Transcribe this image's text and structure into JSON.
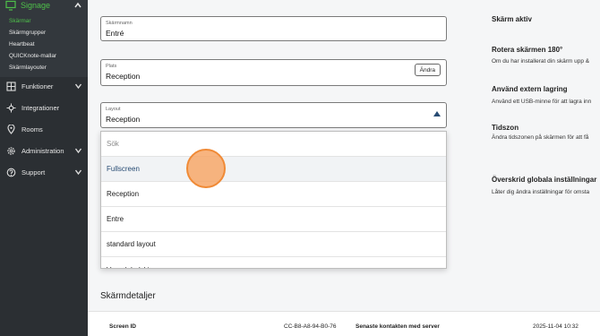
{
  "sidebar": {
    "signage": {
      "label": "Signage",
      "icon": "monitor-icon"
    },
    "subitems": [
      "Skärmar",
      "Skärmgrupper",
      "Heartbeat",
      "QUICKnote-mallar",
      "Skärmlayouter"
    ],
    "items": [
      {
        "label": "Funktioner",
        "icon": "grid-icon",
        "expand": true
      },
      {
        "label": "Integrationer",
        "icon": "plug-icon",
        "expand": false
      },
      {
        "label": "Rooms",
        "icon": "map-pin-icon",
        "expand": false
      },
      {
        "label": "Administration",
        "icon": "gear-icon",
        "expand": true
      },
      {
        "label": "Support",
        "icon": "help-icon",
        "expand": true
      }
    ]
  },
  "form": {
    "screen_name": {
      "label": "Skärmnamn",
      "value": "Entré"
    },
    "place": {
      "label": "Plats",
      "value": "Reception",
      "button": "Ändra"
    },
    "layout": {
      "label": "Layout",
      "value": "Reception"
    }
  },
  "dropdown": {
    "search_placeholder": "Sök",
    "options": [
      "Fullscreen",
      "Reception",
      "Entre",
      "standard layout",
      "Vanadeladskiv"
    ]
  },
  "right_panel": {
    "active_title": "Skärm aktiv",
    "rotate_title": "Rotera skärmen 180°",
    "rotate_desc": "Om du har installerat din skärm upp &",
    "storage_title": "Använd extern lagring",
    "storage_desc": "Använd ett USB-minne för att lagra inn",
    "tz_title": "Tidszon",
    "tz_desc": "Ändra tidszonen på skärmen för att få",
    "override_title": "Överskrid globala inställningar",
    "override_desc": "Låter dig ändra inställningar för omsta"
  },
  "details": {
    "title": "Skärmdetaljer",
    "screen_id_label": "Screen ID",
    "screen_id_value": "CC-B8-A8-94-B0-76",
    "last_contact_label": "Senaste kontakten med server",
    "last_contact_value": "2025-11-04 10:32"
  },
  "colors": {
    "accent_green": "#4ec04a",
    "sidebar_bg": "#2b2f33",
    "primary": "#274b73",
    "cursor": "#f7a768"
  }
}
